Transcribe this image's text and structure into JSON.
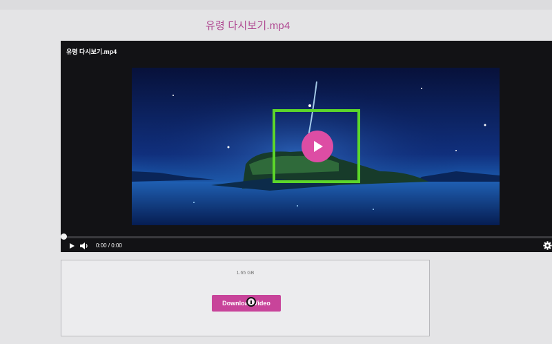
{
  "page": {
    "title": "유령 다시보기.mp4"
  },
  "player": {
    "overlay_title": "유령 다시보기.mp4",
    "time_current": "0:00",
    "time_separator": "/",
    "time_total": "0:00",
    "progress": 0,
    "accent_color": "#dd4da4",
    "highlight_color": "#5cd62a"
  },
  "download": {
    "file_size": "1.65 GB",
    "button_label": "Download Video",
    "button_color": "#c8449a"
  },
  "icons": {
    "big_play": "play-icon",
    "play": "play-icon",
    "volume": "volume-icon",
    "settings": "gear-icon"
  }
}
